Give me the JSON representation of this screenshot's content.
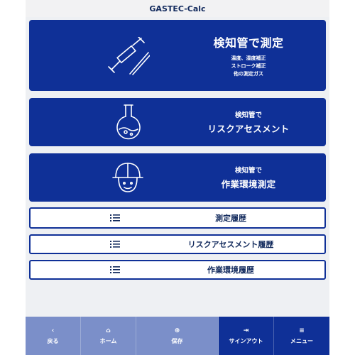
{
  "app": {
    "title": "GASTEC-Calc"
  },
  "cards": [
    {
      "title": "検知管で測定",
      "sub_lines": [
        "温度、湿度補正",
        "ストローク補正",
        "他の測定ガス"
      ],
      "icon": "detector-tube-pump-icon"
    },
    {
      "pre": "検知管で",
      "title": "リスクアセスメント",
      "icon": "flask-icon"
    },
    {
      "pre": "検知管で",
      "title": "作業環境測定",
      "icon": "hard-hat-icon"
    }
  ],
  "history": [
    {
      "label": "測定履歴",
      "icon": "list-icon"
    },
    {
      "label": "リスクアセスメント履歴",
      "icon": "list-icon"
    },
    {
      "label": "作業環境履歴",
      "icon": "list-icon"
    }
  ],
  "nav": {
    "back": {
      "icon": "‹",
      "label": "戻る"
    },
    "home": {
      "icon": "⌂",
      "label": "ホーム"
    },
    "save": {
      "icon": "⊕",
      "label": "保存"
    },
    "signout": {
      "icon": "⇥",
      "label": "サインアウト"
    },
    "menu": {
      "icon": "≡",
      "label": "メニュー"
    }
  },
  "colors": {
    "primary": "#0f3097",
    "nav_inactive": "#7b8fc9",
    "background": "#eef0f3"
  }
}
